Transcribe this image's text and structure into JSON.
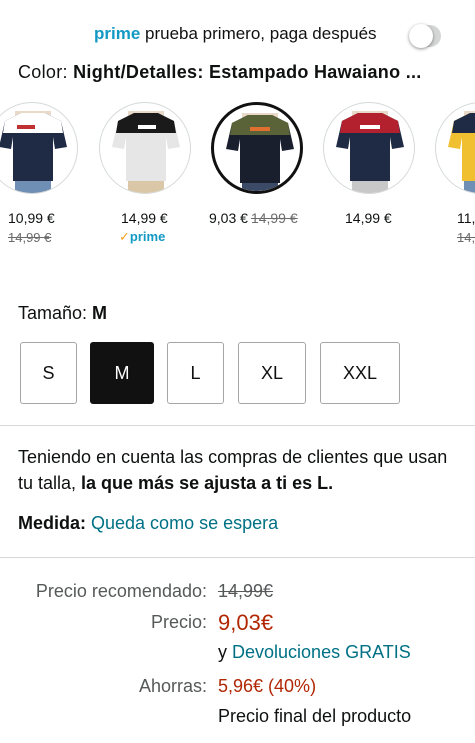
{
  "prime_bar": {
    "prime_word": "prime",
    "text": " prueba primero, paga después",
    "toggle_on": false
  },
  "color": {
    "label": "Color: ",
    "value": "Night/Detalles: Estampado Hawaiano ..."
  },
  "swatches": [
    {
      "price": "10,99 €",
      "old_price": "14,99 €",
      "prime": "",
      "body": "#1f2a44",
      "top": "#ffffff",
      "selected": false
    },
    {
      "price": "14,99 €",
      "old_price": "",
      "prime": "prime",
      "body": "#e6e6e6",
      "top": "#1a1a1a",
      "selected": false
    },
    {
      "price": "9,03 €",
      "old_price": "14,99 €",
      "prime": "",
      "body": "#1a1f2e",
      "top": "#5a6238",
      "selected": true
    },
    {
      "price": "14,99 €",
      "old_price": "",
      "prime": "",
      "body": "#1f2a44",
      "top": "#b3202e",
      "selected": false
    },
    {
      "price": "11,",
      "old_price": "14,",
      "prime": "",
      "body": "#1f2a44",
      "top": "#f0c030",
      "selected": false
    }
  ],
  "size": {
    "label": "Tamaño: ",
    "value": "M",
    "options": [
      "S",
      "M",
      "L",
      "XL",
      "XXL"
    ],
    "selected": "M"
  },
  "fit": {
    "text": "Teniendo en cuenta las compras de clientes que usan tu talla, ",
    "bold": "la que más se ajusta a ti es L.",
    "measure_label": "Medida: ",
    "measure_value": "Queda como se espera"
  },
  "pricing": {
    "recommended_label": "Precio recomendado:",
    "recommended_value": "14,99€",
    "price_label": "Precio:",
    "price_value": "9,03€",
    "returns_prefix": "y ",
    "returns_link": "Devoluciones GRATIS",
    "savings_label": "Ahorras:",
    "savings_value": "5,96€ (40%)",
    "final_note": "Precio final del producto"
  },
  "colors": {
    "accent_link": "#007185",
    "price_red": "#b12704",
    "prime_blue": "#1399c4"
  }
}
